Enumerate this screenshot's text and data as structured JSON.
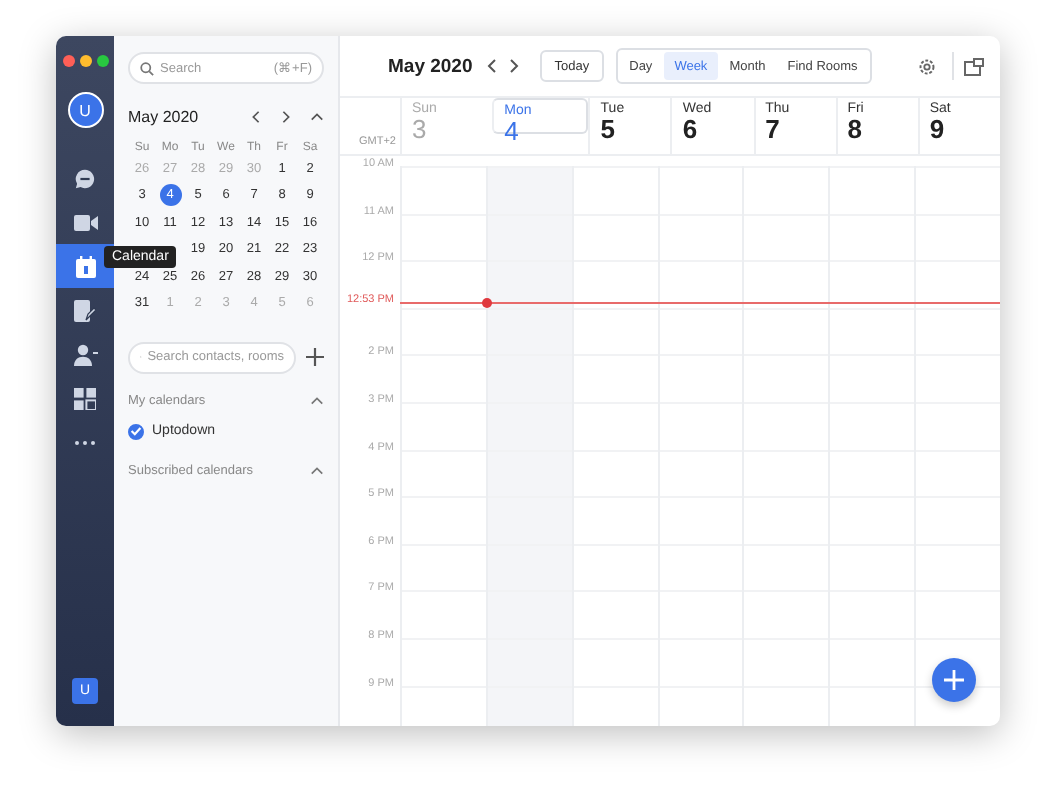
{
  "sidebar": {
    "avatar": "U",
    "items": [
      {
        "kind": "chat",
        "selected": false
      },
      {
        "kind": "video",
        "selected": false
      },
      {
        "kind": "calendar",
        "selected": true,
        "tooltip": "Calendar"
      },
      {
        "kind": "notes",
        "selected": false
      },
      {
        "kind": "contacts",
        "selected": false
      },
      {
        "kind": "apps",
        "selected": false
      },
      {
        "kind": "more",
        "selected": false
      }
    ],
    "account": "U"
  },
  "panel": {
    "search": {
      "placeholder": "Search",
      "shortcut": "(⌘+F)"
    },
    "mini_calendar": {
      "title": "May 2020",
      "weekdays": [
        "Su",
        "Mo",
        "Tu",
        "We",
        "Th",
        "Fr",
        "Sa"
      ],
      "weeks": [
        [
          {
            "text": "26",
            "muted": true,
            "selected": false
          },
          {
            "text": "27",
            "muted": true,
            "selected": false
          },
          {
            "text": "28",
            "muted": true,
            "selected": false
          },
          {
            "text": "29",
            "muted": true,
            "selected": false
          },
          {
            "text": "30",
            "muted": true,
            "selected": false
          },
          {
            "text": "1",
            "muted": false,
            "selected": false
          },
          {
            "text": "2",
            "muted": false,
            "selected": false
          }
        ],
        [
          {
            "text": "3",
            "muted": false,
            "selected": false
          },
          {
            "text": "4",
            "muted": false,
            "selected": true
          },
          {
            "text": "5",
            "muted": false,
            "selected": false
          },
          {
            "text": "6",
            "muted": false,
            "selected": false
          },
          {
            "text": "7",
            "muted": false,
            "selected": false
          },
          {
            "text": "8",
            "muted": false,
            "selected": false
          },
          {
            "text": "9",
            "muted": false,
            "selected": false
          }
        ],
        [
          {
            "text": "10",
            "muted": false,
            "selected": false
          },
          {
            "text": "11",
            "muted": false,
            "selected": false
          },
          {
            "text": "12",
            "muted": false,
            "selected": false
          },
          {
            "text": "13",
            "muted": false,
            "selected": false
          },
          {
            "text": "14",
            "muted": false,
            "selected": false
          },
          {
            "text": "15",
            "muted": false,
            "selected": false
          },
          {
            "text": "16",
            "muted": false,
            "selected": false
          }
        ],
        [
          {
            "text": "19",
            "muted": false,
            "selected": false
          },
          {
            "text": "20",
            "muted": false,
            "selected": false
          },
          {
            "text": "21",
            "muted": false,
            "selected": false
          },
          {
            "text": "22",
            "muted": false,
            "selected": false
          },
          {
            "text": "23",
            "muted": false,
            "selected": false
          }
        ],
        [
          {
            "text": "24",
            "muted": false,
            "selected": false
          },
          {
            "text": "25",
            "muted": false,
            "selected": false
          },
          {
            "text": "26",
            "muted": false,
            "selected": false
          },
          {
            "text": "27",
            "muted": false,
            "selected": false
          },
          {
            "text": "28",
            "muted": false,
            "selected": false
          },
          {
            "text": "29",
            "muted": false,
            "selected": false
          },
          {
            "text": "30",
            "muted": false,
            "selected": false
          }
        ],
        [
          {
            "text": "31",
            "muted": false,
            "selected": false
          },
          {
            "text": "1",
            "muted": true,
            "selected": false
          },
          {
            "text": "2",
            "muted": true,
            "selected": false
          },
          {
            "text": "3",
            "muted": true,
            "selected": false
          },
          {
            "text": "4",
            "muted": true,
            "selected": false
          },
          {
            "text": "5",
            "muted": true,
            "selected": false
          },
          {
            "text": "6",
            "muted": true,
            "selected": false
          }
        ]
      ]
    },
    "contact_search": {
      "placeholder": "Search contacts, rooms"
    },
    "my_calendars": {
      "title": "My calendars",
      "expanded": true,
      "items": [
        {
          "name": "Uptodown",
          "checked": true,
          "color": "#3b73e8"
        }
      ]
    },
    "subscribed_calendars": {
      "title": "Subscribed calendars",
      "expanded": true
    }
  },
  "toolbar": {
    "title": "May 2020",
    "today": "Today",
    "views": [
      {
        "label": "Day",
        "selected": false
      },
      {
        "label": "Week",
        "selected": true
      },
      {
        "label": "Month",
        "selected": false
      },
      {
        "label": "Find Rooms",
        "selected": false
      }
    ]
  },
  "week": {
    "timezone": "GMT+2",
    "days": [
      {
        "name": "Sun",
        "date": "3",
        "kind": "past"
      },
      {
        "name": "Mon",
        "date": "4",
        "kind": "today"
      },
      {
        "name": "Tue",
        "date": "5",
        "kind": "future"
      },
      {
        "name": "Wed",
        "date": "6",
        "kind": "future"
      },
      {
        "name": "Thu",
        "date": "7",
        "kind": "future"
      },
      {
        "name": "Fri",
        "date": "8",
        "kind": "future"
      },
      {
        "name": "Sat",
        "date": "9",
        "kind": "future"
      }
    ],
    "hours": [
      {
        "label": "10 AM"
      },
      {
        "label": "11 AM"
      },
      {
        "label": "12 PM",
        "now": "12:53 PM"
      },
      {
        "label": "2 PM"
      },
      {
        "label": "3 PM"
      },
      {
        "label": "4 PM"
      },
      {
        "label": "5 PM"
      },
      {
        "label": "6 PM"
      },
      {
        "label": "7 PM"
      },
      {
        "label": "8 PM"
      },
      {
        "label": "9 PM"
      }
    ]
  }
}
